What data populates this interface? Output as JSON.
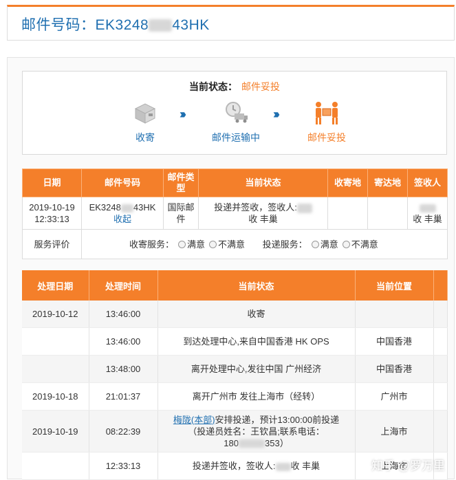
{
  "header": {
    "label": "邮件号码：",
    "number_prefix": "EK3248",
    "number_suffix": "43HK"
  },
  "status_box": {
    "current_label": "当前状态：",
    "current_value": "邮件妥投",
    "steps": [
      {
        "label": "收寄",
        "icon": "package-icon"
      },
      {
        "label": "邮件运输中",
        "icon": "delivery-truck-icon"
      },
      {
        "label": "邮件妥投",
        "icon": "handover-icon"
      }
    ],
    "arrow_glyph": "›››"
  },
  "mail_table": {
    "headers": [
      "日期",
      "邮件号码",
      "邮件类型",
      "当前状态",
      "收寄地",
      "寄达地",
      "签收人"
    ],
    "row": {
      "date": "2019-10-19 12:33:13",
      "number_prefix": "EK3248",
      "number_suffix": "43HK",
      "number_link": "收起",
      "type": "国际邮件",
      "status_prefix": "投递并签收，签收人:",
      "status_suffix": "收 丰巢",
      "origin": "",
      "destination": "",
      "signer_suffix": "收 丰巢"
    },
    "service": {
      "label": "服务评价",
      "send_label": "收寄服务：",
      "deliver_label": "投递服务：",
      "satisfied": "满意",
      "unsatisfied": "不满意"
    }
  },
  "track_table": {
    "headers": [
      "处理日期",
      "处理时间",
      "当前状态",
      "当前位置"
    ],
    "rows": [
      {
        "date": "2019-10-12",
        "time": "13:46:00",
        "status": "收寄",
        "location": ""
      },
      {
        "date": "",
        "time": "13:46:00",
        "status": "到达处理中心,来自中国香港 HK OPS",
        "location": "中国香港"
      },
      {
        "date": "",
        "time": "13:48:00",
        "status": "离开处理中心,发往中国 广州经济",
        "location": "中国香港"
      },
      {
        "date": "2019-10-18",
        "time": "21:01:37",
        "status": "离开广州市 发往上海市（经转）",
        "location": "广州市"
      },
      {
        "date": "2019-10-19",
        "time": "08:22:39",
        "status_link": "梅陇(本部)",
        "status_line1": "安排投递，预计13:00:00前投递",
        "status_line2": "（投递员姓名：王钦昌;联系电话：",
        "phone_prefix": "180",
        "phone_suffix": "353）",
        "location": "上海市"
      },
      {
        "date": "",
        "time": "12:33:13",
        "status_prefix": "投递并签收，签收人:",
        "status_suffix": "收 丰巢",
        "location": "上海市"
      }
    ]
  },
  "watermark": "知乎 @罗万里",
  "colors": {
    "accent": "#f47f2a",
    "link": "#1f6fb0"
  }
}
